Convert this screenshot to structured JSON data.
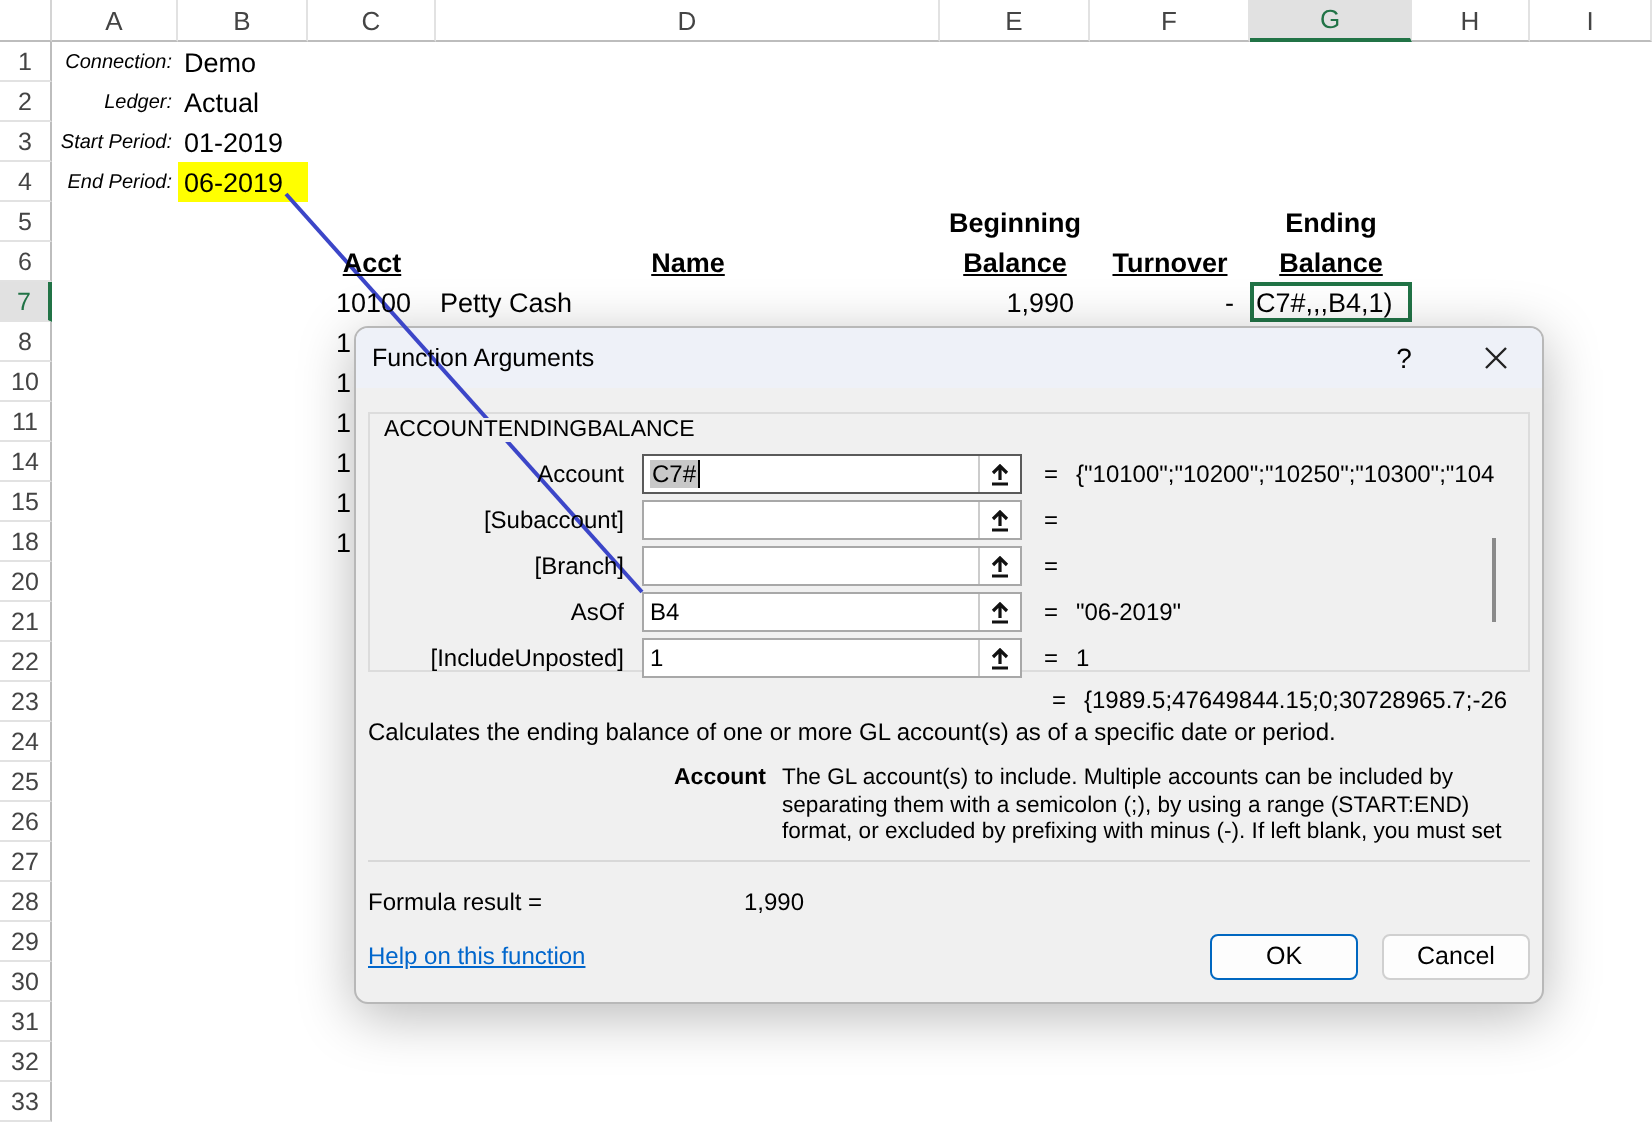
{
  "sheet": {
    "column_headers": [
      {
        "label": "A",
        "selected": false
      },
      {
        "label": "B",
        "selected": false
      },
      {
        "label": "C",
        "selected": false
      },
      {
        "label": "D",
        "selected": false
      },
      {
        "label": "E",
        "selected": false
      },
      {
        "label": "F",
        "selected": false
      },
      {
        "label": "G",
        "selected": true
      },
      {
        "label": "H",
        "selected": false
      },
      {
        "label": "I",
        "selected": false
      }
    ],
    "rows": [
      {
        "number": "1",
        "selected": false,
        "cells": [
          {
            "kind": "label",
            "text": "Connection:",
            "highlighted": false,
            "selected": false
          },
          {
            "kind": "value",
            "text": "Demo",
            "highlighted": false,
            "selected": false
          }
        ]
      },
      {
        "number": "2",
        "selected": false,
        "cells": [
          {
            "kind": "label",
            "text": "Ledger:",
            "highlighted": false,
            "selected": false
          },
          {
            "kind": "value",
            "text": "Actual",
            "highlighted": false,
            "selected": false
          }
        ]
      },
      {
        "number": "3",
        "selected": false,
        "cells": [
          {
            "kind": "label",
            "text": "Start Period:",
            "highlighted": false,
            "selected": false
          },
          {
            "kind": "value",
            "text": "01-2019",
            "highlighted": false,
            "selected": false
          }
        ]
      },
      {
        "number": "4",
        "selected": false,
        "cells": [
          {
            "kind": "label",
            "text": "End Period:",
            "highlighted": false,
            "selected": false
          },
          {
            "kind": "value",
            "text": "06-2019",
            "highlighted": true,
            "selected": false
          }
        ]
      },
      {
        "number": "5",
        "selected": false,
        "cells": [
          {
            "text": ""
          },
          {
            "text": ""
          },
          {
            "text": ""
          },
          {
            "text": ""
          },
          {
            "kind": "heading",
            "text": "Beginning",
            "highlighted": false,
            "selected": false
          },
          {
            "text": ""
          },
          {
            "kind": "heading",
            "text": "Ending",
            "highlighted": false,
            "selected": false
          }
        ]
      },
      {
        "number": "6",
        "selected": false,
        "cells": [
          {
            "text": ""
          },
          {
            "text": ""
          },
          {
            "kind": "header",
            "text": "Acct",
            "highlighted": false,
            "selected": false
          },
          {
            "kind": "header",
            "text": "Name",
            "highlighted": false,
            "selected": false
          },
          {
            "kind": "header",
            "text": "Balance",
            "highlighted": false,
            "selected": false
          },
          {
            "kind": "header",
            "text": "Turnover",
            "highlighted": false,
            "selected": false
          },
          {
            "kind": "header",
            "text": "Balance",
            "highlighted": false,
            "selected": false
          }
        ]
      },
      {
        "number": "7",
        "selected": true,
        "cells": [
          {
            "text": ""
          },
          {
            "text": ""
          },
          {
            "kind": "code",
            "text": "10100",
            "highlighted": false,
            "selected": false
          },
          {
            "kind": "text",
            "text": "Petty Cash",
            "highlighted": false,
            "selected": false
          },
          {
            "kind": "number",
            "text": "1,990",
            "highlighted": false,
            "selected": false
          },
          {
            "kind": "number",
            "text": "-",
            "highlighted": false,
            "selected": false
          },
          {
            "kind": "value",
            "text": "C7#,,,B4,1)",
            "highlighted": false,
            "selected": true
          }
        ]
      },
      {
        "number": "8",
        "selected": false,
        "cells": [
          {
            "text": ""
          },
          {
            "text": ""
          },
          {
            "kind": "code",
            "text": "1",
            "highlighted": false,
            "selected": false
          }
        ]
      },
      {
        "number": "10",
        "selected": false,
        "cells": [
          {
            "text": ""
          },
          {
            "text": ""
          },
          {
            "kind": "code",
            "text": "1",
            "highlighted": false,
            "selected": false
          }
        ]
      },
      {
        "number": "11",
        "selected": false,
        "cells": [
          {
            "text": ""
          },
          {
            "text": ""
          },
          {
            "kind": "code",
            "text": "1",
            "highlighted": false,
            "selected": false
          }
        ]
      },
      {
        "number": "14",
        "selected": false,
        "cells": [
          {
            "text": ""
          },
          {
            "text": ""
          },
          {
            "kind": "code",
            "text": "1",
            "highlighted": false,
            "selected": false
          }
        ]
      },
      {
        "number": "15",
        "selected": false,
        "cells": [
          {
            "text": ""
          },
          {
            "text": ""
          },
          {
            "kind": "code",
            "text": "1",
            "highlighted": false,
            "selected": false
          }
        ]
      },
      {
        "number": "18",
        "selected": false,
        "cells": [
          {
            "text": ""
          },
          {
            "text": ""
          },
          {
            "kind": "code",
            "text": "1",
            "highlighted": false,
            "selected": false
          }
        ]
      },
      {
        "number": "20",
        "selected": false
      },
      {
        "number": "21",
        "selected": false
      },
      {
        "number": "22",
        "selected": false
      },
      {
        "number": "23",
        "selected": false
      },
      {
        "number": "24",
        "selected": false
      },
      {
        "number": "25",
        "selected": false
      },
      {
        "number": "26",
        "selected": false
      },
      {
        "number": "27",
        "selected": false
      },
      {
        "number": "28",
        "selected": false
      },
      {
        "number": "29",
        "selected": false
      },
      {
        "number": "30",
        "selected": false
      },
      {
        "number": "31",
        "selected": false
      },
      {
        "number": "32",
        "selected": false
      },
      {
        "number": "33",
        "selected": false
      }
    ]
  },
  "dialog": {
    "title": "Function Arguments",
    "help": "?",
    "function_name": "ACCOUNTENDINGBALANCE",
    "arguments": [
      {
        "label": "Account",
        "value": "C7#",
        "value_selected": true,
        "equals": "=",
        "result": "{\"10100\";\"10200\";\"10250\";\"10300\";\"104"
      },
      {
        "label": "[Subaccount]",
        "value_selected": false,
        "equals": "="
      },
      {
        "label": "[Branch]",
        "value_selected": false,
        "equals": "="
      },
      {
        "label": "AsOf",
        "value": "B4",
        "value_selected": false,
        "equals": "=",
        "result": "\"06-2019\""
      },
      {
        "label": "[IncludeUnposted]",
        "value": "1",
        "value_selected": false,
        "equals": "=",
        "result": "1"
      }
    ],
    "overall_equals": "=",
    "overall_result": "{1989.5;47649844.15;0;30728965.7;-26",
    "description": "Calculates the ending balance of one or more GL account(s) as of a specific date or period.",
    "argument_help": {
      "name": "Account",
      "text": "The GL account(s) to include. Multiple accounts can be included by separating them with a semicolon (;), by using a range (START:END) format, or excluded by prefixing with minus (-). If left blank, you must set"
    },
    "formula_result_label": "Formula result =",
    "formula_result": "1,990",
    "help_link": "Help on this function",
    "buttons": [
      {
        "label": "OK",
        "default": true
      },
      {
        "label": "Cancel",
        "default": false
      }
    ]
  }
}
